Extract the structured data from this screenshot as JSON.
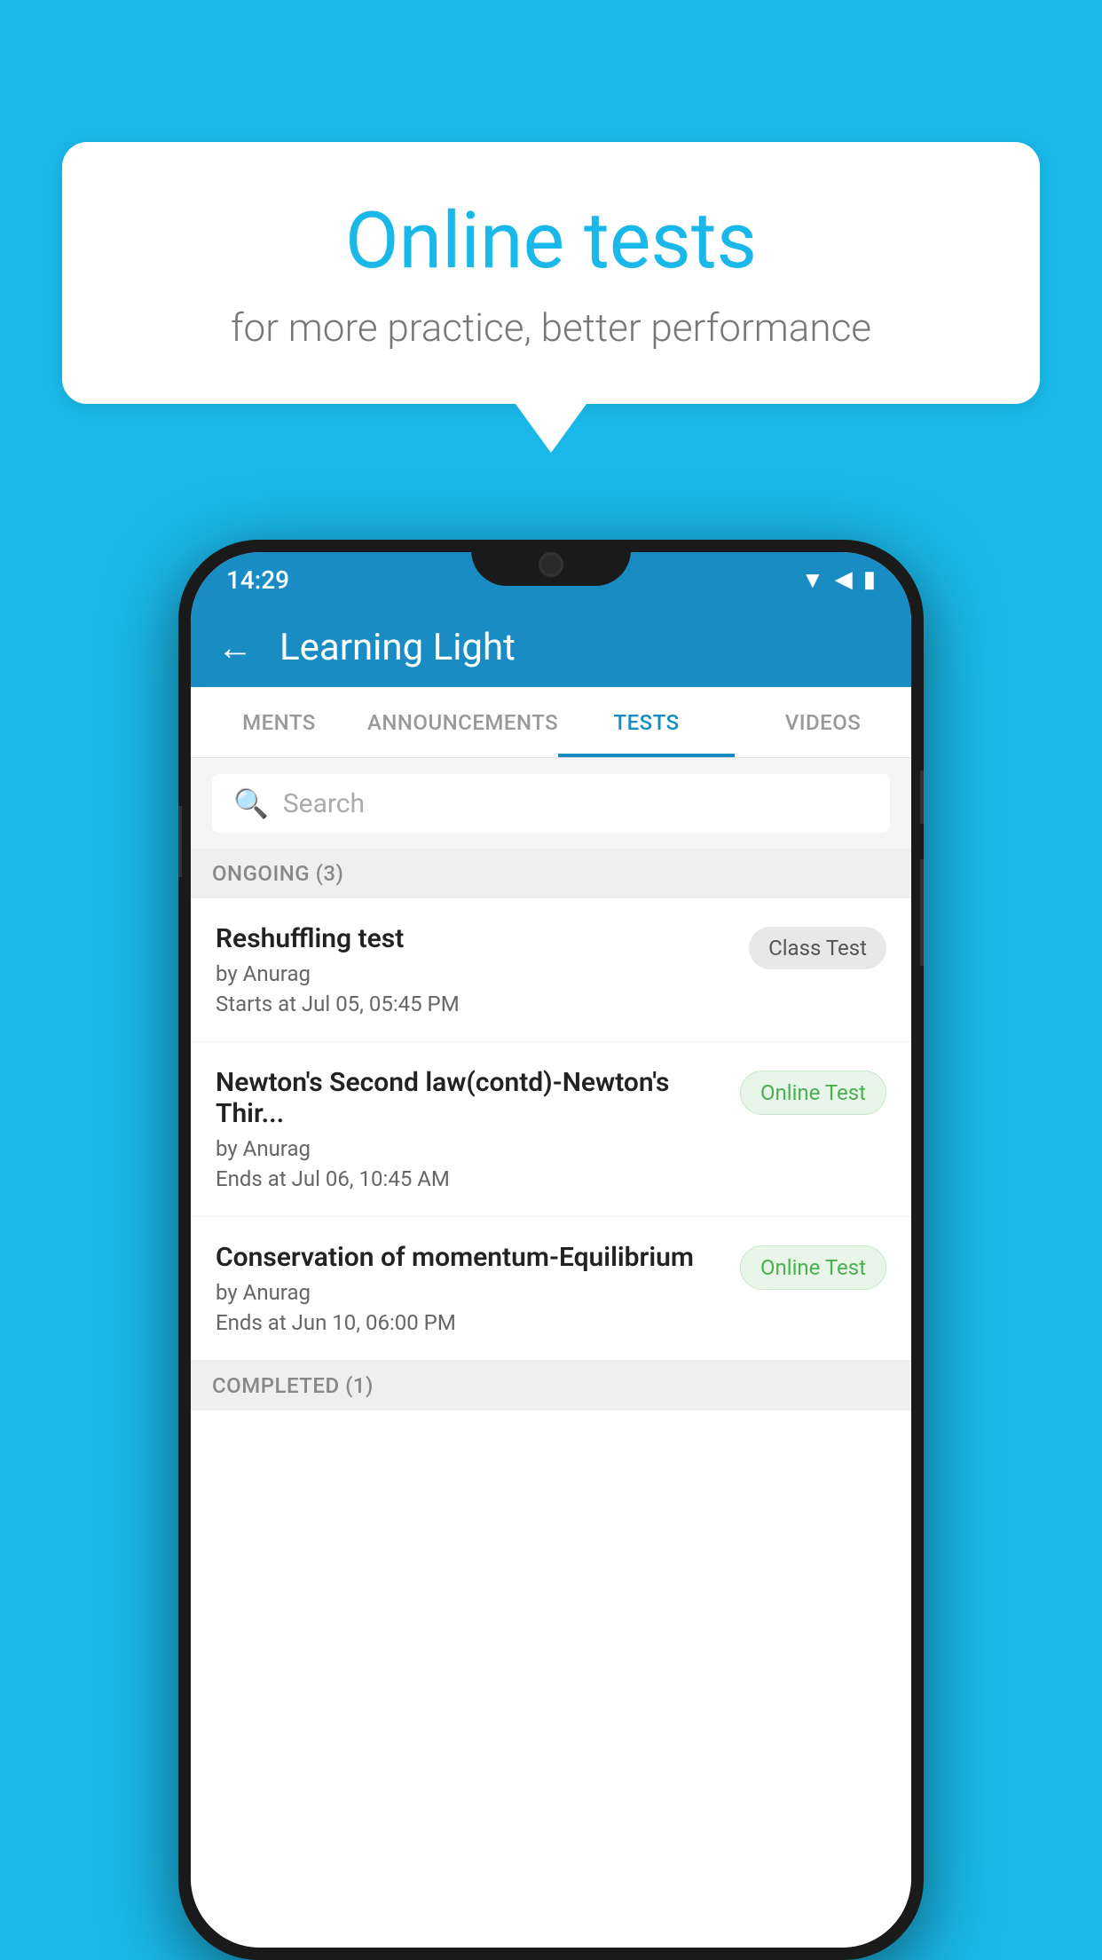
{
  "background_color": "#1ab8e8",
  "speech_bubble": {
    "title": "Online tests",
    "subtitle": "for more practice, better performance"
  },
  "phone": {
    "status_bar": {
      "time": "14:29",
      "icons": [
        "wifi",
        "signal",
        "battery"
      ]
    },
    "header": {
      "title": "Learning Light",
      "back_label": "←"
    },
    "tabs": [
      {
        "label": "MENTS",
        "active": false
      },
      {
        "label": "ANNOUNCEMENTS",
        "active": false
      },
      {
        "label": "TESTS",
        "active": true
      },
      {
        "label": "VIDEOS",
        "active": false
      }
    ],
    "search": {
      "placeholder": "Search"
    },
    "sections": [
      {
        "title": "ONGOING (3)",
        "tests": [
          {
            "name": "Reshuffling test",
            "by": "by Anurag",
            "date": "Starts at  Jul 05, 05:45 PM",
            "badge": "Class Test",
            "badge_type": "class"
          },
          {
            "name": "Newton's Second law(contd)-Newton's Thir...",
            "by": "by Anurag",
            "date": "Ends at  Jul 06, 10:45 AM",
            "badge": "Online Test",
            "badge_type": "online"
          },
          {
            "name": "Conservation of momentum-Equilibrium",
            "by": "by Anurag",
            "date": "Ends at  Jun 10, 06:00 PM",
            "badge": "Online Test",
            "badge_type": "online"
          }
        ]
      }
    ],
    "completed_section": {
      "title": "COMPLETED (1)"
    }
  }
}
